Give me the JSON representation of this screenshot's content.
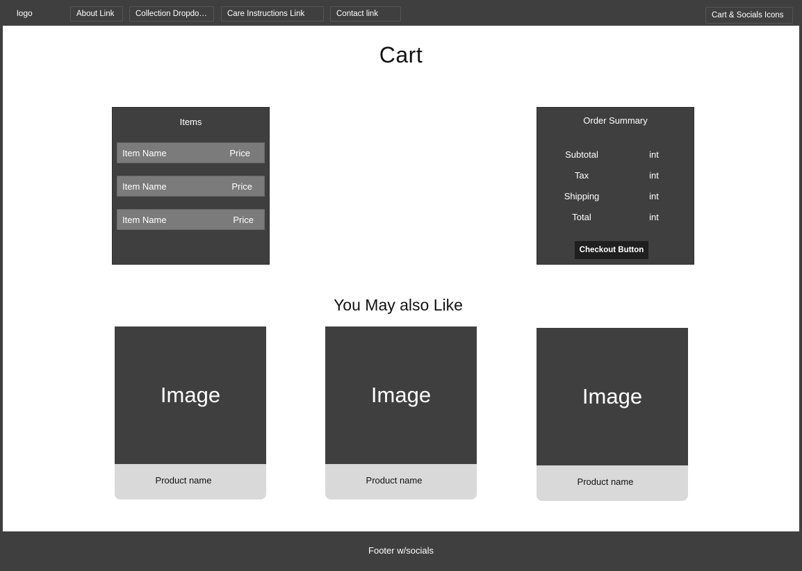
{
  "header": {
    "logo": "logo",
    "nav": [
      {
        "label": "About Link"
      },
      {
        "label": "Collection Dropdown"
      },
      {
        "label": "Care Instructions Link"
      },
      {
        "label": "Contact link"
      }
    ],
    "right": "Cart & Socials Icons"
  },
  "main": {
    "title": "Cart",
    "items_panel": {
      "title": "Items",
      "items": [
        {
          "name": "Item Name",
          "price": "Price"
        },
        {
          "name": "Item Name",
          "price": "Price"
        },
        {
          "name": "Item Name",
          "price": "Price"
        }
      ]
    },
    "summary_panel": {
      "title": "Order Summary",
      "rows": [
        {
          "label": "Subtotal",
          "value": "int"
        },
        {
          "label": "Tax",
          "value": "int"
        },
        {
          "label": "Shipping",
          "value": "int"
        },
        {
          "label": "Total",
          "value": "int"
        }
      ],
      "checkout_label": "Checkout Button"
    },
    "recommend_title": "You May also Like",
    "products": [
      {
        "image_label": "Image",
        "name": "Product name"
      },
      {
        "image_label": "Image",
        "name": "Product name"
      },
      {
        "image_label": "Image",
        "name": "Product name"
      }
    ]
  },
  "footer": {
    "text": "Footer w/socials"
  },
  "colors": {
    "dark": "#3f3f3f",
    "row": "#7b7b7b",
    "card_label_bg": "#d9d9d9",
    "button": "#1f1f1f"
  }
}
